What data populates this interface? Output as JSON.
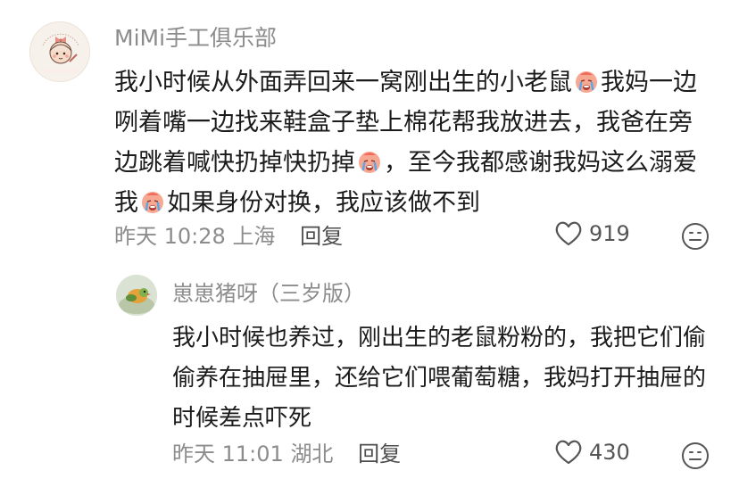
{
  "main_comment": {
    "avatar_alt": "MiMi Art Club",
    "avatar_label": "MIMI手工俱乐部",
    "username": "MiMi手工俱乐部",
    "text_part1": "我小时候从外面弄回来一窝刚出生的小老鼠",
    "text_part2": "我妈一边咧着嘴一边找来鞋盒子垫上棉花帮我放进去，我爸在旁边跳着喊快扔掉快扔掉",
    "text_part3": "，至今我都感谢我妈这么溺爱我",
    "text_part4": "如果身份对换，我应该做不到",
    "emoji": "crying-face",
    "time": "昨天 10:28",
    "location": "上海",
    "reply_label": "回复",
    "like_count": "919"
  },
  "reply_comment": {
    "username": "崽崽猪呀（三岁版）",
    "text": "我小时候也养过，刚出生的老鼠粉粉的，我把它们偷偷养在抽屉里，还给它们喂葡萄糖，我妈打开抽屉的时候差点吓死",
    "time": "昨天 11:01",
    "location": "湖北",
    "reply_label": "回复",
    "like_count": "430"
  },
  "icons": {
    "like": "heart-outline-icon",
    "emoji_react": "smiley-face-icon",
    "emoji_inline": "crying-face-emoji"
  },
  "colors": {
    "text_primary": "#1b1b1b",
    "text_secondary": "#8c8c8c",
    "emoji_face": "#f4a088"
  }
}
